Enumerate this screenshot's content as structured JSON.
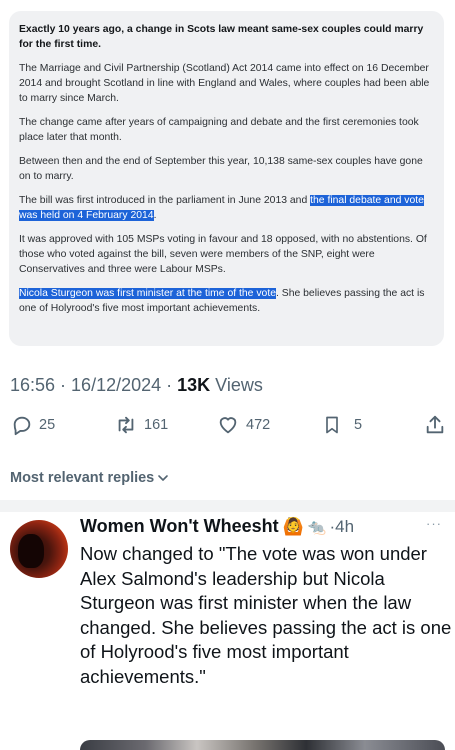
{
  "quoted": {
    "headline": "Exactly 10 years ago, a change in Scots law meant same-sex couples could marry for the first time.",
    "p1": "The Marriage and Civil Partnership (Scotland) Act 2014 came into effect on 16 December 2014 and brought Scotland in line with England and Wales, where couples had been able to marry since March.",
    "p2": "The change came after years of campaigning and debate and the first ceremonies took place later that month.",
    "p3": "Between then and the end of September this year, 10,138 same-sex couples have gone on to marry.",
    "p4_plain": "The bill was first introduced in the parliament in June 2013 and ",
    "p4_highlight": "the final debate and vote was held on 4 February 2014",
    "p4_end": ".",
    "p5": "It was approved with 105 MSPs voting in favour and 18 opposed, with no abstentions. Of those who voted against the bill, seven were members of the SNP, eight were Conservatives and three were Labour MSPs.",
    "p6_highlight": "Nicola Sturgeon was first minister at the time of the vote",
    "p6_plain": ". She believes passing the act is one of Holyrood's five most important achievements."
  },
  "meta": {
    "time": "16:56",
    "sep1": " · ",
    "date": "16/12/2024",
    "sep2": " · ",
    "views": "13K",
    "views_label": " Views"
  },
  "actions": {
    "replies": "25",
    "reposts": "161",
    "likes": "472",
    "bookmarks": "5"
  },
  "replies_filter": "Most relevant replies",
  "reply": {
    "author": "Women Won't Wheesht",
    "emoji1": "🙆",
    "emoji2": "🐀",
    "time": "·4h",
    "more": "···",
    "text": "Now changed to \"The vote was won under Alex Salmond's leadership but Nicola Sturgeon was first minister when the law changed. She believes passing the act is one of Holyrood's five most important achievements.\""
  },
  "colors": {
    "highlight": "#1d63d8",
    "secondary_text": "#536471",
    "card_bg": "#f0f1f3"
  }
}
